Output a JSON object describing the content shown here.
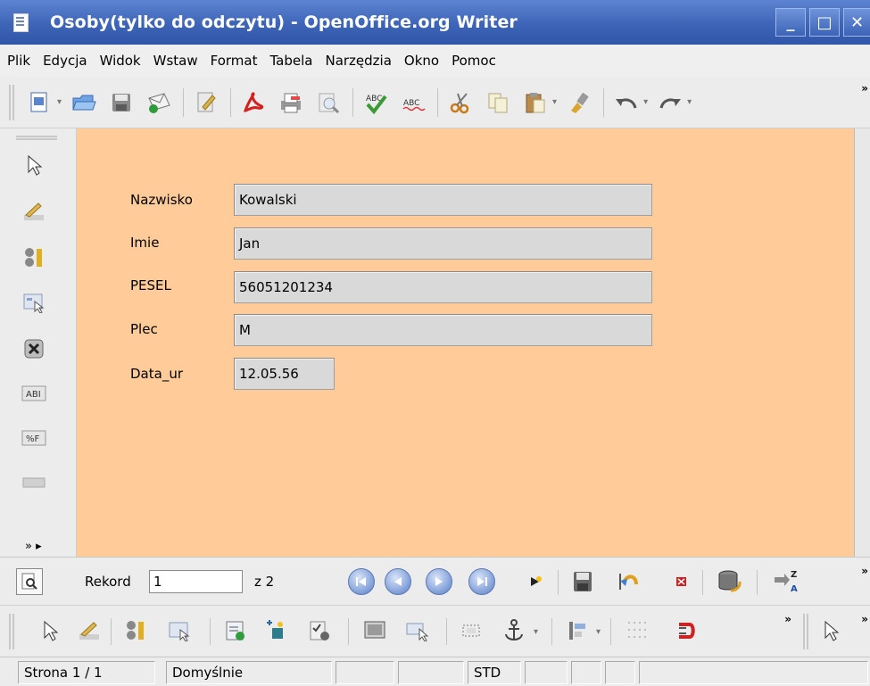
{
  "window": {
    "title": "Osoby(tylko do odczytu) - OpenOffice.org Writer",
    "buttons": {
      "minimize": "_",
      "maximize": "□",
      "close": "✕"
    }
  },
  "menu": {
    "items": [
      "Plik",
      "Edycja",
      "Widok",
      "Wstaw",
      "Format",
      "Tabela",
      "Narzędzia",
      "Okno",
      "Pomoc"
    ]
  },
  "toolbar": {
    "more": "»",
    "icons": [
      "new-document-icon",
      "open-folder-icon",
      "save-icon",
      "send-email-icon",
      "edit-file-icon",
      "export-pdf-icon",
      "print-icon",
      "page-preview-icon",
      "spellcheck-icon",
      "autospellcheck-icon",
      "cut-icon",
      "copy-icon",
      "paste-icon",
      "clone-formatting-icon",
      "undo-icon",
      "redo-icon"
    ],
    "glyphs": {
      "dropdown": "▾",
      "abc": "ABC"
    }
  },
  "sidebar": {
    "icons": [
      "select-arrow-icon",
      "design-mode-icon",
      "control-properties-icon",
      "form-properties-icon",
      "close-control-icon",
      "text-box-icon",
      "formatted-field-icon",
      "more-controls-icon"
    ],
    "labels": {
      "text_box": "ABI",
      "formatted_field": "%F"
    },
    "bottom": "»  ▸"
  },
  "form": {
    "fields": [
      {
        "label": "Nazwisko",
        "value": "Kowalski"
      },
      {
        "label": "Imie",
        "value": "Jan"
      },
      {
        "label": "PESEL",
        "value": "56051201234"
      },
      {
        "label": "Plec",
        "value": "M"
      },
      {
        "label": "Data_ur",
        "value": "12.05.56"
      }
    ]
  },
  "navigation": {
    "record_label": "Rekord",
    "record_value": "1",
    "total_label": "z 2",
    "more": "»"
  },
  "formbar": {
    "more": "»"
  },
  "status": {
    "page": "Strona 1 / 1",
    "style": "Domyślnie",
    "mode": "STD"
  },
  "colors": {
    "titlebar": "#3e64b8",
    "document_background": "#ffcc99",
    "field_background": "#d9d9d9"
  }
}
